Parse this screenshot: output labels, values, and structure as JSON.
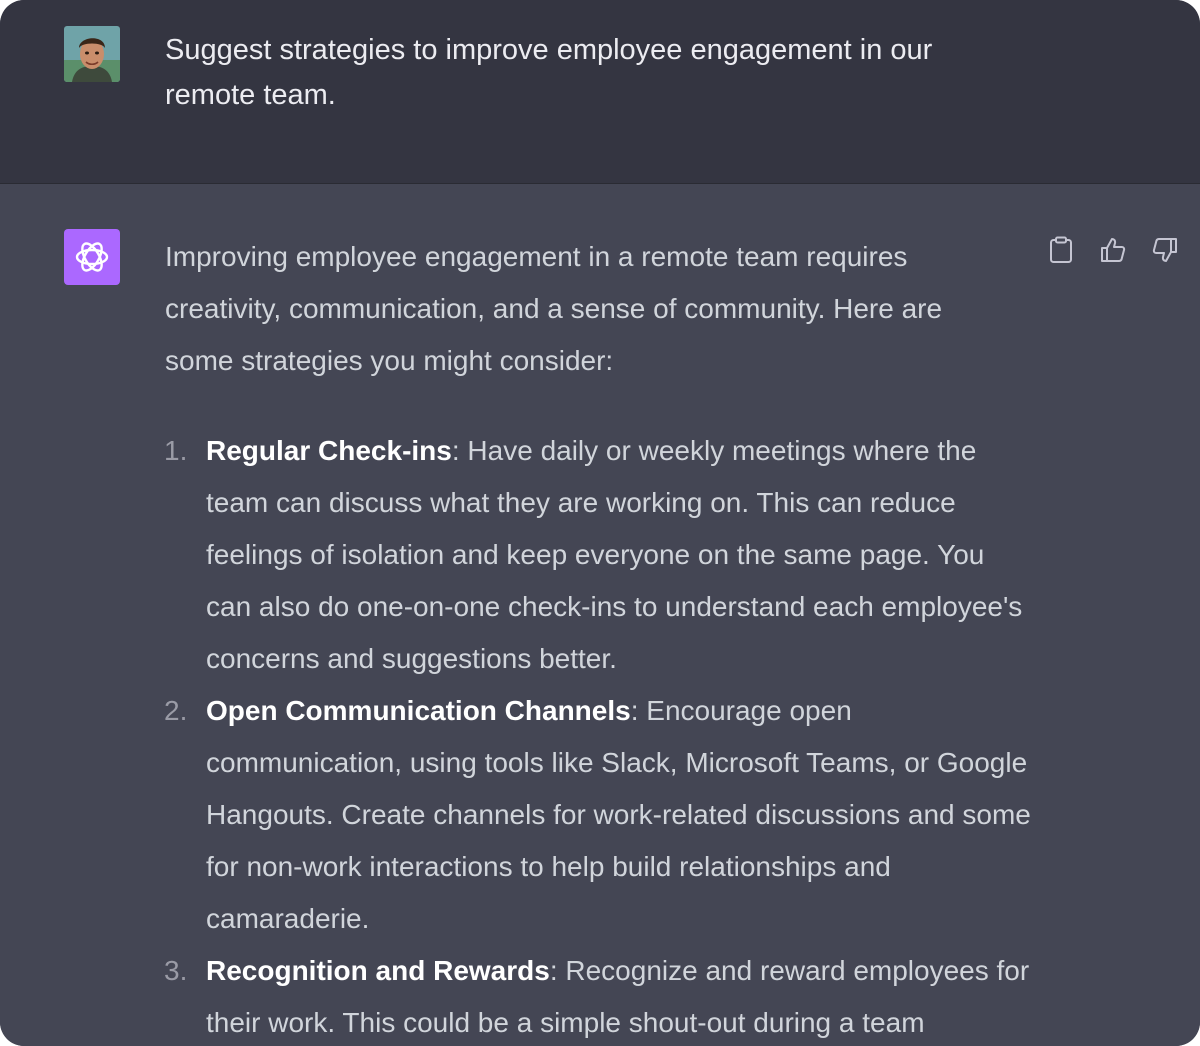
{
  "user_message": {
    "text": "Suggest strategies to improve employee engagement in our remote team."
  },
  "assistant_message": {
    "intro": "Improving employee engagement in a remote team requires creativity, communication, and a sense of community. Here are some strategies you might consider:",
    "items": [
      {
        "number": "1.",
        "title": "Regular Check-ins",
        "text": ": Have daily or weekly meetings where the team can discuss what they are working on. This can reduce feelings of isolation and keep everyone on the same page. You can also do one-on-one check-ins to understand each employee's concerns and suggestions better."
      },
      {
        "number": "2.",
        "title": "Open Communication Channels",
        "text": ": Encourage open communication, using tools like Slack, Microsoft Teams, or Google Hangouts. Create channels for work-related discussions and some for non-work interactions to help build relationships and camaraderie."
      },
      {
        "number": "3.",
        "title": "Recognition and Rewards",
        "text": ": Recognize and reward employees for their work. This could be a simple shout-out during a team"
      }
    ]
  },
  "icons": {
    "user_avatar": "user-avatar",
    "assistant_avatar": "openai-logo-icon",
    "copy": "clipboard-icon",
    "like": "thumbs-up-icon",
    "dislike": "thumbs-down-icon"
  },
  "colors": {
    "user_bg": "#343541",
    "assistant_bg": "#444654",
    "assistant_avatar_bg": "#ab68ff",
    "text": "#d1d5db"
  }
}
